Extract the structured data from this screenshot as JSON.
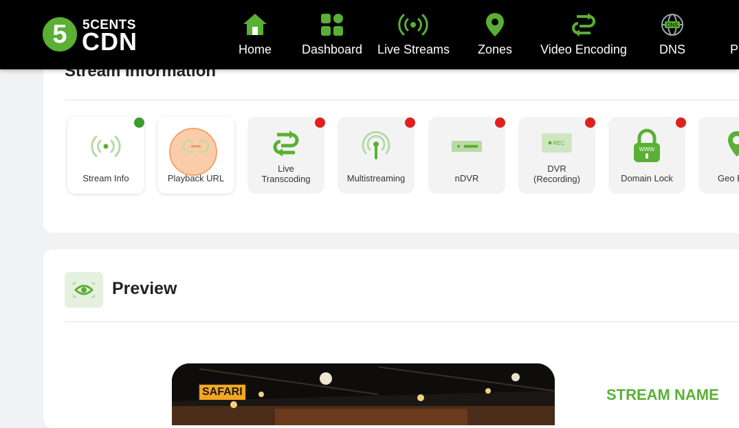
{
  "brand": {
    "logo_numeral": "5",
    "logo_top": "5CENTS",
    "logo_bottom": "CDN",
    "accent": "#5ab034"
  },
  "nav": {
    "items": [
      {
        "label": "Home",
        "icon": "home-icon"
      },
      {
        "label": "Dashboard",
        "icon": "dashboard-icon"
      },
      {
        "label": "Live Streams",
        "icon": "broadcast-icon"
      },
      {
        "label": "Zones",
        "icon": "location-pin-icon"
      },
      {
        "label": "Video Encoding",
        "icon": "transcode-arrows-icon"
      },
      {
        "label": "DNS",
        "icon": "globe-dns-icon"
      },
      {
        "label": "Pl",
        "icon": "plugin-icon"
      }
    ]
  },
  "stream_info": {
    "title": "Stream Information",
    "features": [
      {
        "label": "Stream Info",
        "icon": "broadcast-icon",
        "status": "green"
      },
      {
        "label": "Playback URL",
        "icon": "link-icon",
        "status": "none"
      },
      {
        "label": "Live\nTranscoding",
        "icon": "transcode-arrows-icon",
        "status": "red"
      },
      {
        "label": "Multistreaming",
        "icon": "antenna-icon",
        "status": "red"
      },
      {
        "label": "nDVR",
        "icon": "ndvr-icon",
        "status": "red"
      },
      {
        "label": "DVR\n(Recording)",
        "icon": "rec-icon",
        "status": "red"
      },
      {
        "label": "Domain Lock",
        "icon": "www-lock-icon",
        "status": "red"
      },
      {
        "label": "Geo B",
        "icon": "geo-pin-icon",
        "status": "none"
      }
    ],
    "rec_text": "REC",
    "www_text": "WWW",
    "dns_text": "DNS"
  },
  "preview": {
    "title": "Preview",
    "video_badge": "SAFARI",
    "stream_name_label": "STREAM NAME"
  }
}
